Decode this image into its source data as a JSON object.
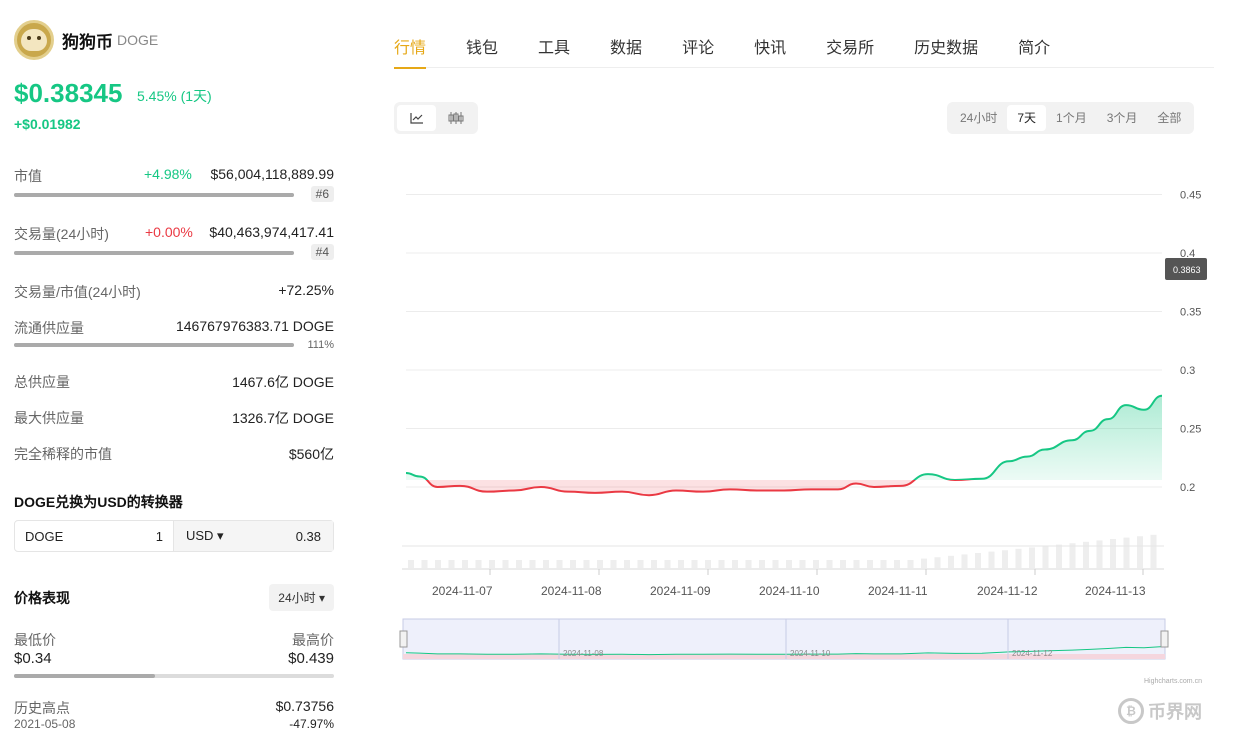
{
  "coin": {
    "name": "狗狗币",
    "symbol": "DOGE",
    "price": "$0.38345",
    "change_pct": "5.45% (1天)",
    "change_abs": "+$0.01982"
  },
  "stats": {
    "market_cap": {
      "label": "市值",
      "change": "+4.98%",
      "value": "$56,004,118,889.99",
      "rank": "#6"
    },
    "volume": {
      "label": "交易量(24小时)",
      "change": "+0.00%",
      "value": "$40,463,974,417.41",
      "rank": "#4"
    },
    "vol_mcap": {
      "label": "交易量/市值(24小时)",
      "value": "+72.25%"
    },
    "circulating": {
      "label": "流通供应量",
      "value": "146767976383.71 DOGE",
      "pct": "111%"
    },
    "total_supply": {
      "label": "总供应量",
      "value": "1467.6亿 DOGE"
    },
    "max_supply": {
      "label": "最大供应量",
      "value": "1326.7亿 DOGE"
    },
    "fdv": {
      "label": "完全稀释的市值",
      "value": "$560亿"
    }
  },
  "converter": {
    "title": "DOGE兑换为USD的转换器",
    "from_symbol": "DOGE",
    "from_amount": "1",
    "to_symbol": "USD ▾",
    "to_amount": "0.38"
  },
  "performance": {
    "title": "价格表现",
    "period": "24小时 ▾",
    "low_label": "最低价",
    "low_value": "$0.34",
    "high_label": "最高价",
    "high_value": "$0.439",
    "range_position": 0.44,
    "ath_label": "历史高点",
    "ath_value": "$0.73756",
    "ath_date": "2021-05-08",
    "ath_change": "-47.97%"
  },
  "nav": {
    "tabs": [
      "行情",
      "钱包",
      "工具",
      "数据",
      "评论",
      "快讯",
      "交易所",
      "历史数据",
      "简介"
    ],
    "active": 0
  },
  "chart_controls": {
    "ranges": [
      "24小时",
      "7天",
      "1个月",
      "3个月",
      "全部"
    ],
    "active_range": 1
  },
  "chart_data": {
    "type": "area",
    "ylim": [
      0.2,
      0.45
    ],
    "y_ticks": [
      "0.45",
      "0.4",
      "0.35",
      "0.3",
      "0.25",
      "0.2"
    ],
    "x_tick_labels": [
      "2024-11-07",
      "2024-11-08",
      "2024-11-09",
      "2024-11-10",
      "2024-11-11",
      "2024-11-12",
      "2024-11-13"
    ],
    "baseline": 0.206,
    "last_price_label": "0.3863",
    "navigator_labels": [
      "2024-11-08",
      "2024-11-10",
      "2024-11-12"
    ],
    "credit": "Highcharts.com.cn",
    "colors": {
      "up": "#16c784",
      "down": "#ea3943"
    },
    "series": [
      {
        "x": [
          0,
          3,
          7,
          12,
          18,
          24,
          30,
          36,
          42,
          48,
          54,
          60,
          66,
          72,
          78,
          84,
          90,
          96,
          100,
          104,
          110,
          116,
          122,
          128,
          134,
          138,
          142,
          148,
          152,
          156,
          160,
          164,
          168
        ],
        "values": [
          0.212,
          0.209,
          0.2,
          0.201,
          0.196,
          0.197,
          0.2,
          0.196,
          0.195,
          0.196,
          0.193,
          0.197,
          0.196,
          0.198,
          0.197,
          0.197,
          0.198,
          0.198,
          0.203,
          0.2,
          0.201,
          0.211,
          0.206,
          0.207,
          0.222,
          0.226,
          0.232,
          0.24,
          0.248,
          0.258,
          0.27,
          0.266,
          0.278
        ]
      }
    ]
  },
  "watermark": "币界网"
}
